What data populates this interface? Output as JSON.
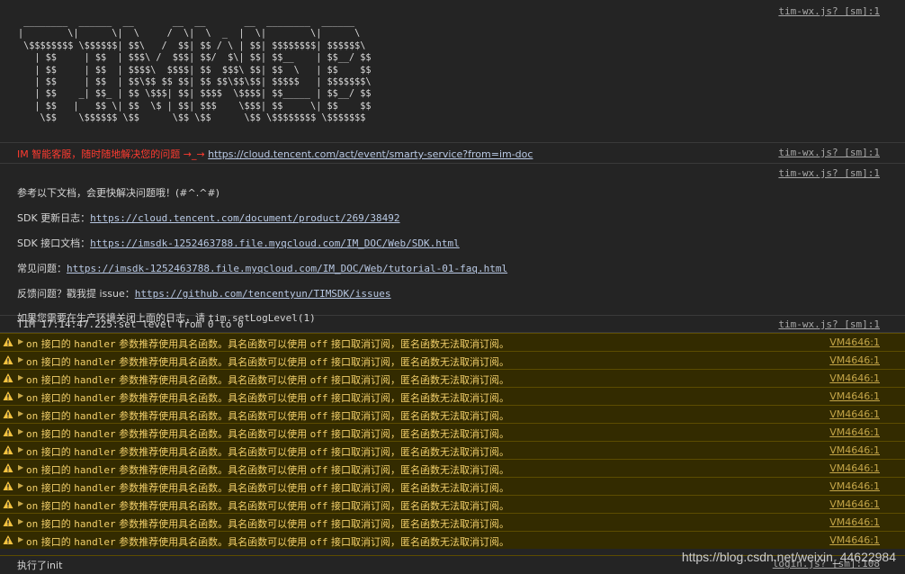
{
  "art": {
    "lines": [
      " ________  ______  __       __  __       __  ________  ______  ",
      "|        \\|      \\|  \\     /  \\|  \\  _  |  \\|        \\|      \\ ",
      " \\$$$$$$$$ \\$$$$$$| $$\\   /  $$| $$ / \\ | $$| $$$$$$$$| $$$$$$\\",
      "   | $$     | $$  | $$$\\ /  $$$| $$/  $\\| $$| $$__    | $$__/ $$",
      "   | $$     | $$  | $$$$\\  $$$$| $$  $$$\\ $$| $$  \\   | $$    $$",
      "   | $$     | $$  | $$\\$$ $$ $$| $$ $$\\$$\\$$| $$$$$   | $$$$$$$\\",
      "   | $$    _| $$_ | $$ \\$$$| $$| $$$$  \\$$$$| $$_____ | $$__/ $$",
      "   | $$   |   $$ \\| $$  \\$ | $$| $$$    \\$$$| $$     \\| $$    $$",
      "    \\$$    \\$$$$$$ \\$$      \\$$ \\$$      \\$$ \\$$$$$$$$ \\$$$$$$$ "
    ],
    "source": "tim-wx.js? [sm]:1"
  },
  "service": {
    "text": "IM 智能客服，随时随地解决您的问题 ",
    "arrow": "→_→",
    "url": "https://cloud.tencent.com/act/event/smarty-service?from=im-doc",
    "source": "tim-wx.js? [sm]:1"
  },
  "info": {
    "source": "tim-wx.js? [sm]:1",
    "intro": "参考以下文档，会更快解决问题哦！(#^.^#)",
    "changelog_label": "SDK 更新日志：",
    "changelog_url": "https://cloud.tencent.com/document/product/269/38492",
    "api_label": "SDK 接口文档：",
    "api_url": "https://imsdk-1252463788.file.myqcloud.com/IM_DOC/Web/SDK.html",
    "faq_label": "常见问题：",
    "faq_url": "https://imsdk-1252463788.file.myqcloud.com/IM_DOC/Web/tutorial-01-faq.html",
    "issue_label": "反馈问题？戳我提 issue：",
    "issue_url": "https://github.com/tencentyun/TIMSDK/issues",
    "prod_prefix": "如果您需要在生产环境关闭上面的日志，请 ",
    "prod_code": "tim.setLogLevel(1)"
  },
  "tim_log": {
    "text": "TIM 17:14:47.225:set level from 0 to 0",
    "source": "tim-wx.js? [sm]:1"
  },
  "warning": {
    "text_a": "on",
    "text_b": " 接口的 ",
    "text_c": "handler",
    "text_d": " 参数推荐使用具名函数。具名函数可以使用 ",
    "text_e": "off",
    "text_f": " 接口取消订阅，匿名函数无法取消订阅。",
    "source": "VM4646:1",
    "count": 12
  },
  "last": {
    "text": "执行了init",
    "source": "login.js? [sm]:108"
  },
  "watermark": "https://blog.csdn.net/weixin_44622984",
  "colors": {
    "background": "#242424",
    "warning_bg": "#332b00",
    "warning_text": "#f2cf6a",
    "error_text": "#ff3b30"
  }
}
